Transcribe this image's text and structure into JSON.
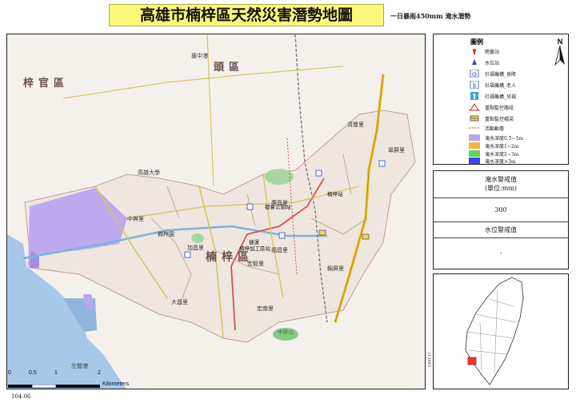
{
  "header": {
    "title": "高雄市楠梓區天然災害潛勢地圖",
    "subtitle": "一日暴雨450mm 淹水潛勢"
  },
  "legend": {
    "title": "圖例",
    "north": "N",
    "items": [
      {
        "label": "雨量站",
        "icon": "rain-gauge-icon"
      },
      {
        "label": "水位站",
        "icon": "water-level-icon"
      },
      {
        "label": "社福機構_身障",
        "icon": "disabled-welfare-icon"
      },
      {
        "label": "社福機構_老人",
        "icon": "elderly-welfare-icon"
      },
      {
        "label": "社福機構_兒福",
        "icon": "child-welfare-icon"
      },
      {
        "label": "重點監控路段",
        "icon": "warning-road-icon"
      },
      {
        "label": "重點監控橋梁",
        "icon": "bridge-icon"
      },
      {
        "label": "活動斷層",
        "icon": "fault-line-icon"
      },
      {
        "label": "淹水深度0.5~1m",
        "color": "#b9a6ee"
      },
      {
        "label": "淹水深度1~2m",
        "color": "#f4b540"
      },
      {
        "label": "淹水深度2~3m",
        "color": "#5fd65c"
      },
      {
        "label": "淹水深度>3m",
        "color": "#3e44f0"
      }
    ]
  },
  "warning_values": {
    "flood_label": "淹水警戒值",
    "flood_unit": "(單位:mm)",
    "flood_value": "300",
    "water_label": "水位警戒值",
    "water_value": "-"
  },
  "map": {
    "district_label": "楠梓區",
    "neighbor_north_left": "梓官區",
    "neighbor_north_center": "頭區",
    "places": [
      {
        "label": "援中港"
      },
      {
        "label": "左營港"
      },
      {
        "label": "中興里"
      },
      {
        "label": "楠梓園"
      },
      {
        "label": "大昌里"
      },
      {
        "label": "加昌里"
      },
      {
        "label": "宏毅里"
      },
      {
        "label": "宏南里"
      },
      {
        "label": "廣昌里"
      },
      {
        "label": "福昌里"
      },
      {
        "label": "清豐里"
      },
      {
        "label": "錦屏里"
      },
      {
        "label": "翠屏里"
      },
      {
        "label": "楠梓加工區站"
      },
      {
        "label": "都會公園站"
      },
      {
        "label": "楠梓站"
      },
      {
        "label": "捷運"
      },
      {
        "label": "半屏山"
      },
      {
        "label": "高雄大學"
      }
    ],
    "scale": {
      "ticks": [
        "0",
        "0.5",
        "1",
        "2"
      ],
      "unit": "Kilometers"
    }
  },
  "footer": {
    "date": "104.06",
    "code": "213083"
  }
}
